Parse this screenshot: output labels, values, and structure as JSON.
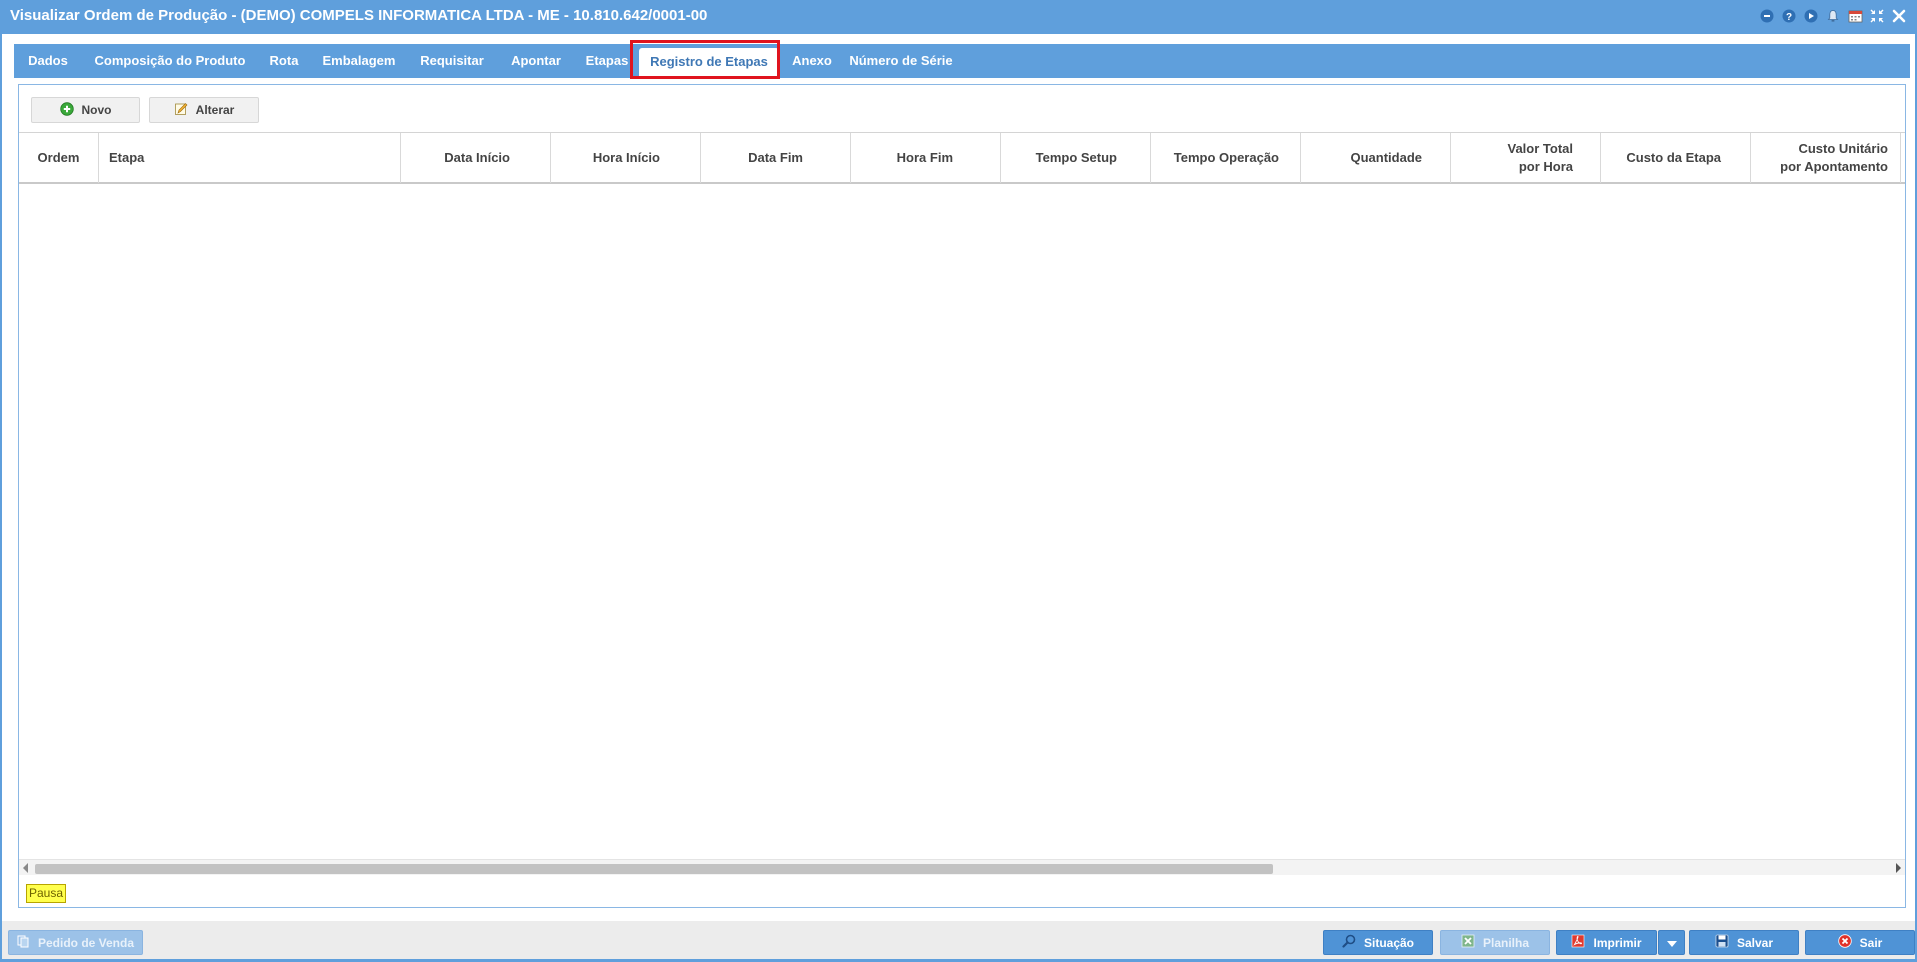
{
  "window": {
    "title": "Visualizar Ordem de Produção - (DEMO) COMPELS INFORMATICA LTDA - ME - 10.810.642/0001-00"
  },
  "title_icons": [
    "minimize-circle-icon",
    "help-icon",
    "play-icon",
    "bell-icon",
    "calendar-icon",
    "shrink-icon",
    "close-icon"
  ],
  "tabs": [
    {
      "label": "Dados"
    },
    {
      "label": "Composição do Produto"
    },
    {
      "label": "Rota"
    },
    {
      "label": "Embalagem"
    },
    {
      "label": "Requisitar"
    },
    {
      "label": "Apontar"
    },
    {
      "label": "Etapas"
    },
    {
      "label": "Registro de Etapas",
      "active": true
    },
    {
      "label": "Anexo"
    },
    {
      "label": "Número de Série"
    }
  ],
  "toolbar": {
    "new_label": "Novo",
    "edit_label": "Alterar"
  },
  "grid": {
    "columns": {
      "ordem": "Ordem",
      "etapa": "Etapa",
      "data_inicio": "Data Início",
      "hora_inicio": "Hora Início",
      "data_fim": "Data Fim",
      "hora_fim": "Hora Fim",
      "tempo_setup": "Tempo Setup",
      "tempo_operacao": "Tempo Operação",
      "quantidade": "Quantidade",
      "valor_total_l1": "Valor Total",
      "valor_total_l2": "por Hora",
      "custo_etapa": "Custo da Etapa",
      "custo_unitario_l1": "Custo Unitário",
      "custo_unitario_l2": "por Apontamento"
    },
    "rows": []
  },
  "legend": {
    "pause_label": "Pausa"
  },
  "footer": {
    "sales_order": "Pedido de Venda",
    "situation": "Situação",
    "spreadsheet": "Planilha",
    "print": "Imprimir",
    "save": "Salvar",
    "exit": "Sair"
  },
  "colors": {
    "accent": "#5f9fdc",
    "highlight": "#e0141e",
    "pause": "#ffff4d"
  }
}
